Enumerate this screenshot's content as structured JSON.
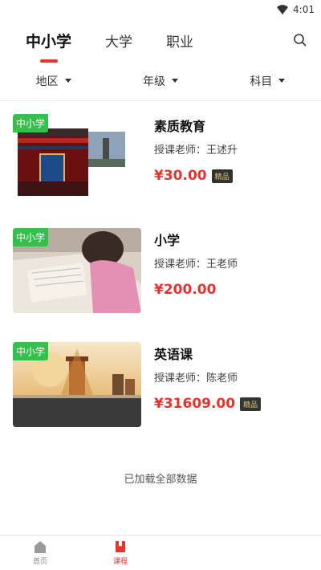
{
  "status": {
    "time": "4:01"
  },
  "tabs": [
    {
      "label": "中小学",
      "active": true
    },
    {
      "label": "大学",
      "active": false
    },
    {
      "label": "职业",
      "active": false
    }
  ],
  "filters": [
    {
      "label": "地区"
    },
    {
      "label": "年级"
    },
    {
      "label": "科目"
    }
  ],
  "courses": [
    {
      "tag": "中小学",
      "title": "素质教育",
      "teacher": "授课老师：王述升",
      "price": "¥30.00",
      "badge": "精品"
    },
    {
      "tag": "中小学",
      "title": "小学",
      "teacher": "授课老师：王老师",
      "price": "¥200.00",
      "badge": ""
    },
    {
      "tag": "中小学",
      "title": "英语课",
      "teacher": "授课老师：陈老师",
      "price": "¥31609.00",
      "badge": "精品"
    }
  ],
  "footer_text": "已加载全部数据",
  "bottom_nav": [
    {
      "label": "首页",
      "icon": "home-icon"
    },
    {
      "label": "课程",
      "icon": "course-icon",
      "active": true
    }
  ],
  "colors": {
    "accent": "#e8322e",
    "tag_green": "#35c04c",
    "badge_bg": "#333333",
    "badge_text": "#e6c77a"
  }
}
